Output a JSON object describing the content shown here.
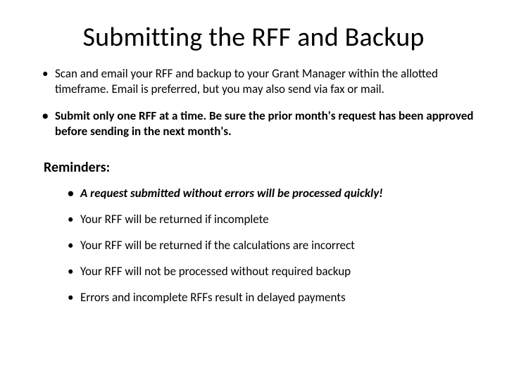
{
  "title": "Submitting the RFF and Backup",
  "bullets": [
    "Scan and email your RFF and backup to your Grant Manager within the allotted timeframe. Email is preferred, but you may also send via fax or mail.",
    "Submit only one RFF at a time. Be sure the prior month's request has been approved before sending in the next month's."
  ],
  "reminders_heading": "Reminders:",
  "reminders": [
    "A request submitted without errors will be processed quickly!",
    "Your RFF will be returned if incomplete",
    "Your RFF will be returned if the calculations are incorrect",
    "Your RFF will  not be processed without required backup",
    "Errors and incomplete RFFs result in delayed payments"
  ]
}
